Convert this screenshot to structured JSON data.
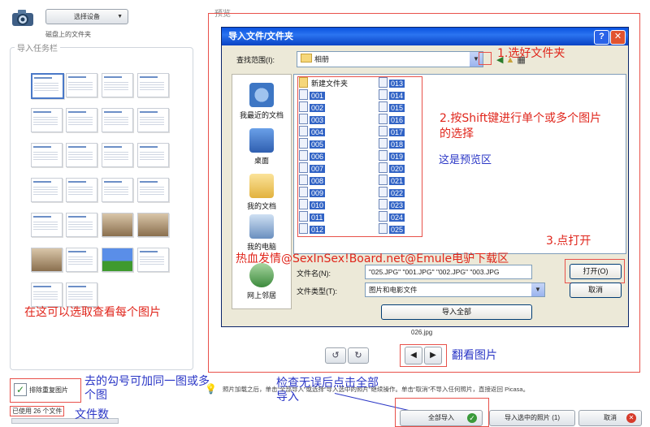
{
  "left_panel": {
    "device_button": "选择设备",
    "disk_label": "磁盘上的文件夹",
    "task_group_label": "导入任务栏",
    "exclude_duplicates": "排除重复图片",
    "files_used": "已使用 26 个文件"
  },
  "preview": {
    "label": "预览",
    "photo_name": "026.jpg"
  },
  "dialog": {
    "title": "导入文件/文件夹",
    "help": "?",
    "close": "✕",
    "look_in_label": "查找范围(I):",
    "look_in_value": "相册",
    "places": [
      "我最近的文档",
      "桌面",
      "我的文档",
      "我的电脑",
      "网上邻居"
    ],
    "folder": "新建文件夹",
    "files_col1": [
      "001",
      "002",
      "003",
      "004",
      "005",
      "006",
      "007",
      "008",
      "009",
      "010",
      "011",
      "012"
    ],
    "files_col2": [
      "013",
      "014",
      "015",
      "016",
      "017",
      "018",
      "019",
      "020",
      "021",
      "022",
      "023",
      "024",
      "025"
    ],
    "filename_label": "文件名(N):",
    "filename_value": "\"025.JPG\" \"001.JPG\" \"002.JPG\" \"003.JPG",
    "filetype_label": "文件类型(T):",
    "filetype_value": "图片和电影文件",
    "open_button": "打开(O)",
    "cancel_button": "取消",
    "import_all_button": "导入全部"
  },
  "bottom": {
    "hint": "照片加载之后，单击“全部导入”或选择“导入选中的照片”继续操作。单击“取消”不导入任何照片，直接返回 Picasa。",
    "import_all": "全部导入",
    "import_selected": "导入选中的照片 (1)",
    "cancel": "取消"
  },
  "annotations": {
    "a1": "1.选好文件夹",
    "a2": "2.按Shift键进行单个或多个图片的选择",
    "a3": "这是预览区",
    "a4": "3.点打开",
    "a5": "热血发情@SexInSex!Board.net@Emule电驴下载区",
    "a6": "在这可以选取查看每个图片",
    "a7": "翻看图片",
    "a8": "去的勾号可加同一图或多个图",
    "a9": "检查无误后点击全部导入",
    "a10": "文件数"
  },
  "icons": [
    "camera-icon",
    "folder-icon",
    "back-icon",
    "up-folder-icon",
    "view-menu-icon",
    "rotate-left-icon",
    "rotate-right-icon",
    "prev-icon",
    "next-icon",
    "check-icon",
    "bulb-icon",
    "cancel-icon"
  ],
  "colors": {
    "annotation_blue": "#2a36c6",
    "annotation_red": "#e0261c",
    "xp_title": "#0a52e0",
    "selection": "#3163c5"
  }
}
